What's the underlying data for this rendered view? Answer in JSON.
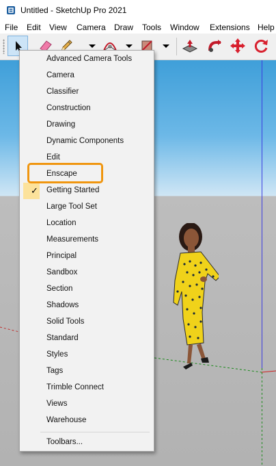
{
  "window": {
    "title": "Untitled - SketchUp Pro 2021"
  },
  "menubar": {
    "items": [
      "File",
      "Edit",
      "View",
      "Camera",
      "Draw",
      "Tools",
      "Window",
      "Extensions",
      "Help"
    ]
  },
  "toolbar": {
    "tools": [
      "select-tool",
      "eraser-tool",
      "line-tool",
      "arc-tool",
      "shape-tool",
      "push-pull-tool",
      "follow-me-tool",
      "move-tool",
      "rotate-tool"
    ]
  },
  "toolbars_menu": {
    "items": [
      {
        "label": "Advanced Camera Tools",
        "checked": false
      },
      {
        "label": "Camera",
        "checked": false
      },
      {
        "label": "Classifier",
        "checked": false
      },
      {
        "label": "Construction",
        "checked": false
      },
      {
        "label": "Drawing",
        "checked": false
      },
      {
        "label": "Dynamic Components",
        "checked": false
      },
      {
        "label": "Edit",
        "checked": false
      },
      {
        "label": "Enscape",
        "checked": false,
        "highlighted": true
      },
      {
        "label": "Getting Started",
        "checked": true
      },
      {
        "label": "Large Tool Set",
        "checked": false
      },
      {
        "label": "Location",
        "checked": false
      },
      {
        "label": "Measurements",
        "checked": false
      },
      {
        "label": "Principal",
        "checked": false
      },
      {
        "label": "Sandbox",
        "checked": false
      },
      {
        "label": "Section",
        "checked": false
      },
      {
        "label": "Shadows",
        "checked": false
      },
      {
        "label": "Solid Tools",
        "checked": false
      },
      {
        "label": "Standard",
        "checked": false
      },
      {
        "label": "Styles",
        "checked": false
      },
      {
        "label": "Tags",
        "checked": false
      },
      {
        "label": "Trimble Connect",
        "checked": false
      },
      {
        "label": "Views",
        "checked": false
      },
      {
        "label": "Warehouse",
        "checked": false
      }
    ],
    "footer": "Toolbars...",
    "check_glyph": "✓"
  },
  "colors": {
    "highlight_outline": "#f0960f",
    "checked_background": "#fce29b",
    "sky": "#3f9fd9",
    "ground": "#b2b2b2"
  }
}
